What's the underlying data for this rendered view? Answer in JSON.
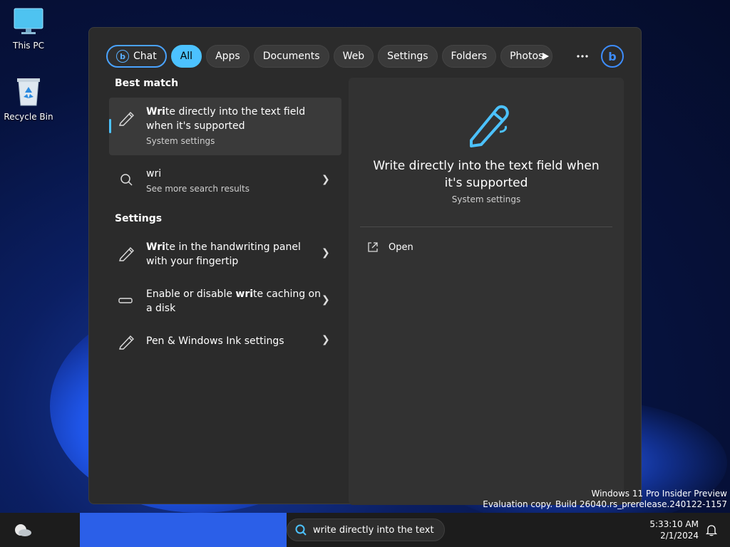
{
  "desktop": {
    "icons": [
      {
        "label": "This PC",
        "icon": "monitor-icon"
      },
      {
        "label": "Recycle Bin",
        "icon": "recycle-bin-icon"
      }
    ],
    "watermark": {
      "line1": "Windows 11 Pro Insider Preview",
      "line2": "Evaluation copy. Build 26040.rs_prerelease.240122-1157"
    }
  },
  "search_panel": {
    "tabs": [
      {
        "label": "Chat",
        "icon": "bing-icon"
      },
      {
        "label": "All",
        "active": true
      },
      {
        "label": "Apps"
      },
      {
        "label": "Documents"
      },
      {
        "label": "Web"
      },
      {
        "label": "Settings"
      },
      {
        "label": "Folders"
      },
      {
        "label": "Photos"
      }
    ],
    "tools": {
      "play": "play-icon",
      "more": "more-icon",
      "bing": "bing-icon"
    },
    "best_match_heading": "Best match",
    "best_match": {
      "title_bold": "Wri",
      "title_rest": "te directly into the text field when it's supported",
      "subtitle": "System settings",
      "icon": "pen-icon"
    },
    "web_result": {
      "query": "wri",
      "subtitle": "See more search results",
      "icon": "search-icon"
    },
    "settings_heading": "Settings",
    "settings_results": [
      {
        "bold": "Wri",
        "rest": "te in the handwriting panel with your fingertip",
        "pre": "",
        "icon": "pen-icon"
      },
      {
        "pre": "Enable or disable ",
        "bold": "wri",
        "rest": "te caching on a disk",
        "icon": "drive-icon"
      },
      {
        "pre": "Pen & Windows Ink settings",
        "bold": "",
        "rest": "",
        "icon": "pen-icon"
      }
    ],
    "detail": {
      "title": "Write directly into the text field when it's supported",
      "subtitle": "System settings",
      "action_label": "Open",
      "colors": {
        "accent": "#4cc2ff"
      }
    }
  },
  "taskbar": {
    "search_text": "write directly into the text f",
    "time": "5:33:10 AM",
    "date": "2/1/2024"
  }
}
